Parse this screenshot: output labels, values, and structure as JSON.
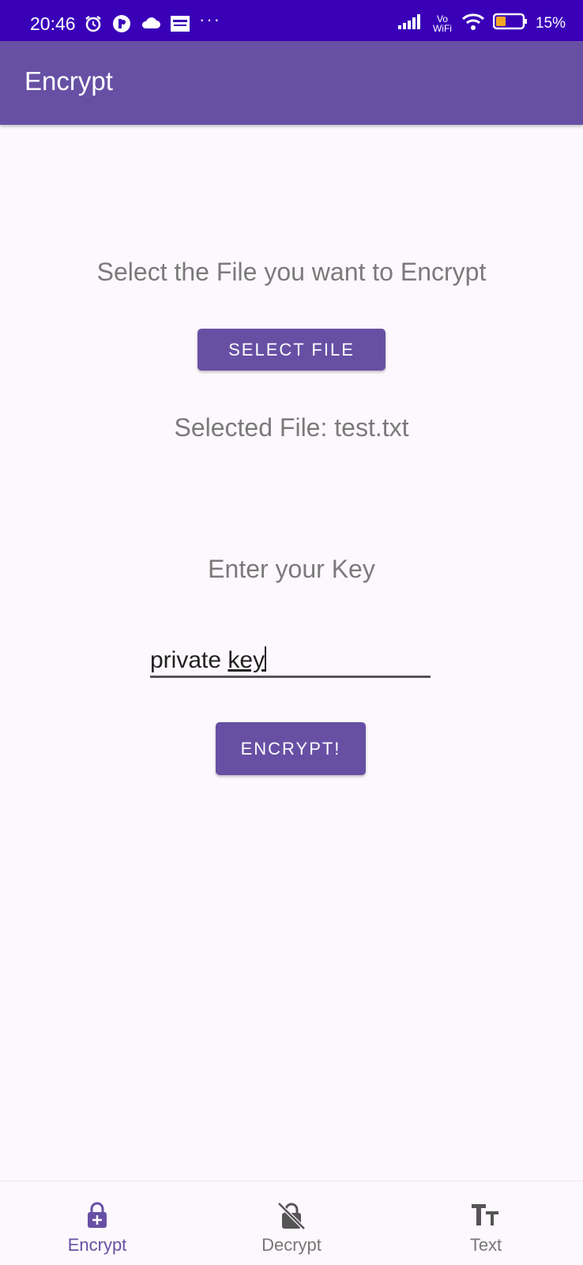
{
  "status_bar": {
    "time": "20:46",
    "dots": "···",
    "network_label": "Vo WiFi",
    "battery_percent": "15%",
    "battery_level": 0.15,
    "icons": [
      "alarm-icon",
      "app-icon",
      "cloud-icon",
      "espn-icon",
      "signal-icon",
      "wifi-icon",
      "battery-icon"
    ]
  },
  "app_bar": {
    "title": "Encrypt"
  },
  "main": {
    "select_prompt": "Select the File you want to Encrypt",
    "select_button": "SELECT FILE",
    "selected_file": "Selected File: test.txt",
    "key_prompt": "Enter your Key",
    "key_value_plain": "private ",
    "key_value_underlined": "key",
    "encrypt_button": "ENCRYPT!"
  },
  "bottom_nav": {
    "items": [
      {
        "label": "Encrypt",
        "icon": "lock-add-icon",
        "active": true
      },
      {
        "label": "Decrypt",
        "icon": "lock-crossed-icon",
        "active": false
      },
      {
        "label": "Text",
        "icon": "text-size-icon",
        "active": false
      }
    ]
  },
  "colors": {
    "status_bar": "#3a00b8",
    "primary": "#6750a4",
    "background": "#fdf8fd",
    "prompt_text": "#7a7a7a"
  }
}
